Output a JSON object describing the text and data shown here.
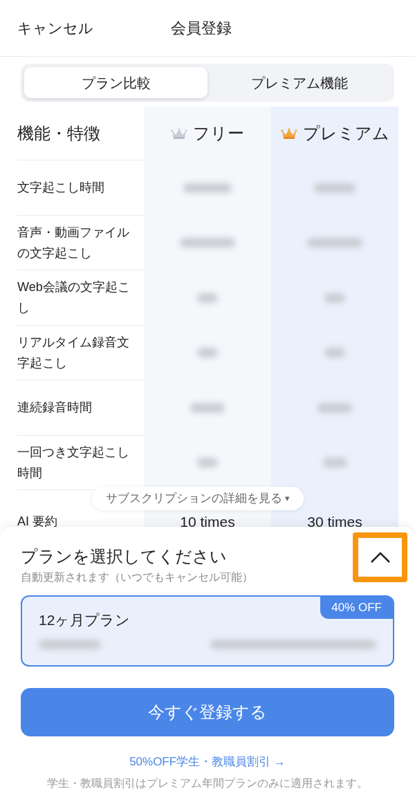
{
  "header": {
    "cancel": "キャンセル",
    "title": "会員登録"
  },
  "tabs": [
    {
      "label": "プラン比較",
      "selected": true
    },
    {
      "label": "プレミアム機能",
      "selected": false
    }
  ],
  "table": {
    "columns": [
      {
        "label": "機能・特徴",
        "kind": "feature"
      },
      {
        "label": "フリー",
        "kind": "free"
      },
      {
        "label": "プレミアム",
        "kind": "premium"
      }
    ],
    "rows": [
      {
        "feature": "文字起こし時間"
      },
      {
        "feature": "音声・動画ファイルの文字起こし"
      },
      {
        "feature": "Web会議の文字起こし"
      },
      {
        "feature": "リアルタイム録音文字起こし"
      },
      {
        "feature": "連続録音時間"
      },
      {
        "feature": "一回つき文字起こし時間"
      },
      {
        "feature": "AI 要約",
        "free": "10 times",
        "premium": "30 times"
      }
    ]
  },
  "details_toggle": {
    "label": "サブスクリプションの詳細を見る",
    "caret": "▾"
  },
  "sheet": {
    "title": "プランを選択してください",
    "subtitle": "自動更新されます（いつでもキャンセル可能）",
    "collapse_highlighted": true,
    "plans": [
      {
        "name": "12ヶ月プラン",
        "badge": "40% OFF",
        "selected": true
      }
    ],
    "button": "今すぐ登録する",
    "discount_link": "50%OFF学生・教職員割引 →",
    "note": "学生・教職員割引はプレミアム年間プランのみに適用されます。"
  }
}
